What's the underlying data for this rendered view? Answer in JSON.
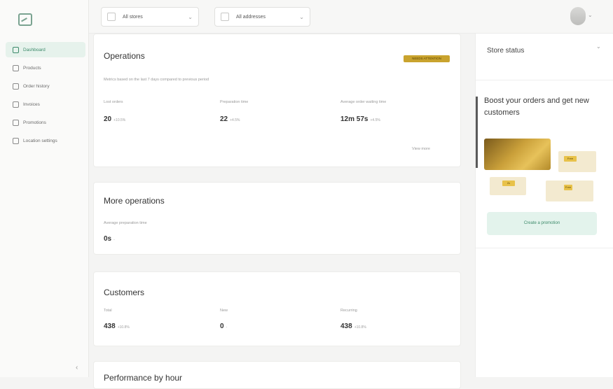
{
  "header": {
    "store_select": "All stores",
    "address_select": "All addresses"
  },
  "sidebar": {
    "items": [
      {
        "label": "Dashboard"
      },
      {
        "label": "Products"
      },
      {
        "label": "Order history"
      },
      {
        "label": "Invoices"
      },
      {
        "label": "Promotions"
      },
      {
        "label": "Location settings"
      }
    ]
  },
  "operations": {
    "title": "Operations",
    "badge": "NEEDS ATTENTION",
    "subtitle": "Metrics based on the last 7 days compared to previous period",
    "metrics": [
      {
        "label": "Lost orders",
        "value": "20",
        "delta": "+10.5%"
      },
      {
        "label": "Preparation time",
        "value": "22",
        "delta": "+4.5%"
      },
      {
        "label": "Average order waiting time",
        "value": "12m 57s",
        "delta": "+4.5%"
      }
    ],
    "link": "View more"
  },
  "more_operations": {
    "title": "More operations",
    "metric_label": "Average preparation time",
    "metric_value": "0s",
    "metric_delta": "-"
  },
  "customers": {
    "title": "Customers",
    "metrics": [
      {
        "label": "Total",
        "value": "438",
        "delta": "+10.8%"
      },
      {
        "label": "New",
        "value": "0",
        "delta": "-"
      },
      {
        "label": "Recurring",
        "value": "438",
        "delta": "+10.8%"
      }
    ]
  },
  "next_card": {
    "title": "Performance by hour"
  },
  "right_panel": {
    "store_status": "Store status",
    "boost_title": "Boost your orders and get new customers",
    "promo_tags": [
      "Free",
      "2x",
      "Free"
    ],
    "button": "Create a promotion"
  }
}
